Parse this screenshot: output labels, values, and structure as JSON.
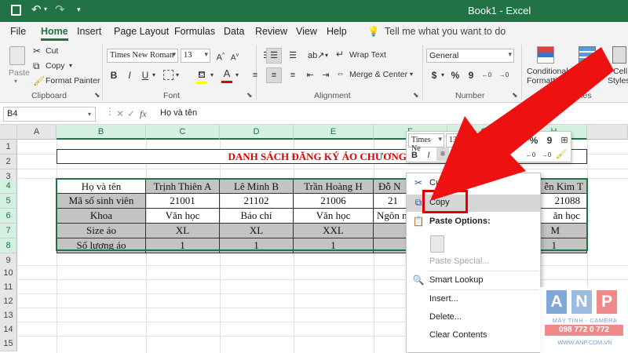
{
  "titlebar": {
    "title": "Book1 - Excel",
    "save_icon": "save-icon",
    "undo_icon": "undo-icon",
    "redo_icon": "redo-icon"
  },
  "menu": {
    "items": [
      "File",
      "Home",
      "Insert",
      "Page Layout",
      "Formulas",
      "Data",
      "Review",
      "View",
      "Help"
    ],
    "active": "Home",
    "tell_me": "Tell me what you want to do"
  },
  "ribbon": {
    "clipboard": {
      "paste": "Paste",
      "cut": "Cut",
      "copy": "Copy",
      "format_painter": "Format Painter",
      "label": "Clipboard"
    },
    "font": {
      "name": "Times New Roman",
      "size": "13",
      "bold": "B",
      "italic": "I",
      "underline": "U",
      "font_color_letter": "A",
      "label": "Font"
    },
    "alignment": {
      "wrap": "Wrap Text",
      "merge": "Merge & Center",
      "label": "Alignment"
    },
    "number": {
      "format": "General",
      "currency": "$",
      "percent": "%",
      "comma": "9",
      "label": "Number"
    },
    "styles": {
      "conditional": "Conditional",
      "conditional2": "Formatting",
      "format_table": "Format as",
      "format_table2": "Table",
      "cell_styles": "Cell",
      "cell_styles2": "Styles",
      "label": "Styles"
    }
  },
  "formula_bar": {
    "name_box": "B4",
    "fx": "fx",
    "content": "Họ và tên"
  },
  "sheet": {
    "columns": [
      "A",
      "B",
      "C",
      "D",
      "E",
      "F",
      "G",
      "H"
    ],
    "rows": [
      "1",
      "2",
      "3",
      "4",
      "5",
      "6",
      "7",
      "8",
      "9",
      "10",
      "11",
      "12",
      "13",
      "14",
      "15"
    ],
    "title": "DANH SÁCH ĐĂNG KÝ ÁO CHƯƠNG T",
    "table": [
      [
        "Họ và tên",
        "Trịnh Thiên A",
        "Lê Minh B",
        "Trần Hoàng H",
        "Đỗ N",
        "",
        "ễn Kim T"
      ],
      [
        "Mã số sinh viên",
        "21001",
        "21102",
        "21006",
        "21",
        "",
        "21088"
      ],
      [
        "Khoa",
        "Văn học",
        "Báo chí",
        "Văn học",
        "Ngôn n",
        "",
        "ăn học"
      ],
      [
        "Size áo",
        "XL",
        "XL",
        "XXL",
        "",
        "",
        "M"
      ],
      [
        "Số lượng áo",
        "1",
        "1",
        "1",
        "",
        "",
        "1"
      ]
    ]
  },
  "mini_toolbar": {
    "font": "Times Ne",
    "size": "13",
    "bold": "B",
    "italic": "I",
    "currency": "$",
    "percent": "%",
    "comma": "9"
  },
  "context_menu": {
    "items": [
      {
        "label": "Cut",
        "icon": "scissors-icon",
        "state": "normal"
      },
      {
        "label": "Copy",
        "icon": "copy-icon",
        "state": "hover"
      },
      {
        "label": "Paste Options:",
        "icon": "paste-icon",
        "state": "heading"
      },
      {
        "label": "Paste Special...",
        "icon": "",
        "state": "disabled"
      },
      {
        "label": "Smart Lookup",
        "icon": "search-icon",
        "state": "normal"
      },
      {
        "label": "Insert...",
        "icon": "",
        "state": "normal"
      },
      {
        "label": "Delete...",
        "icon": "",
        "state": "normal"
      },
      {
        "label": "Clear Contents",
        "icon": "",
        "state": "normal"
      }
    ]
  },
  "watermark": {
    "letters": [
      "A",
      "N",
      "P"
    ],
    "line1": "MÁY TÍNH - CAMERA",
    "phone": "098 772 0 772",
    "site": "WWW.ANP.COM.VN"
  },
  "colors": {
    "excel_green": "#217346",
    "title_red": "#e00000",
    "annotation_red": "#ee1111",
    "highlight_gray": "#c3c3c3"
  }
}
